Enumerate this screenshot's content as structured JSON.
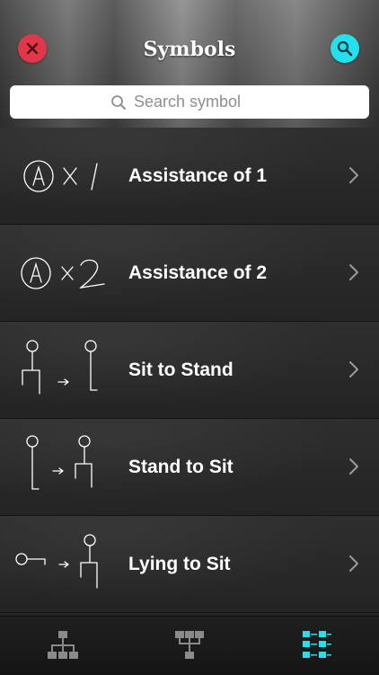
{
  "header": {
    "title": "Symbols",
    "close_icon": "close-icon",
    "search_icon": "search-icon",
    "close_color": "#e0384a",
    "search_color": "#23e0ec"
  },
  "search": {
    "placeholder": "Search symbol",
    "value": ""
  },
  "symbols": [
    {
      "label": "Assistance of 1",
      "icon": "assistance-of-1-symbol"
    },
    {
      "label": "Assistance of 2",
      "icon": "assistance-of-2-symbol"
    },
    {
      "label": "Sit to Stand",
      "icon": "sit-to-stand-symbol"
    },
    {
      "label": "Stand to Sit",
      "icon": "stand-to-sit-symbol"
    },
    {
      "label": "Lying to Sit",
      "icon": "lying-to-sit-symbol"
    }
  ],
  "tabbar": {
    "tabs": [
      {
        "icon": "hierarchy-icon",
        "active": false
      },
      {
        "icon": "branch-icon",
        "active": false
      },
      {
        "icon": "symbols-grid-icon",
        "active": true
      }
    ],
    "active_color": "#23e0ec",
    "inactive_color": "#8a8a8a"
  }
}
